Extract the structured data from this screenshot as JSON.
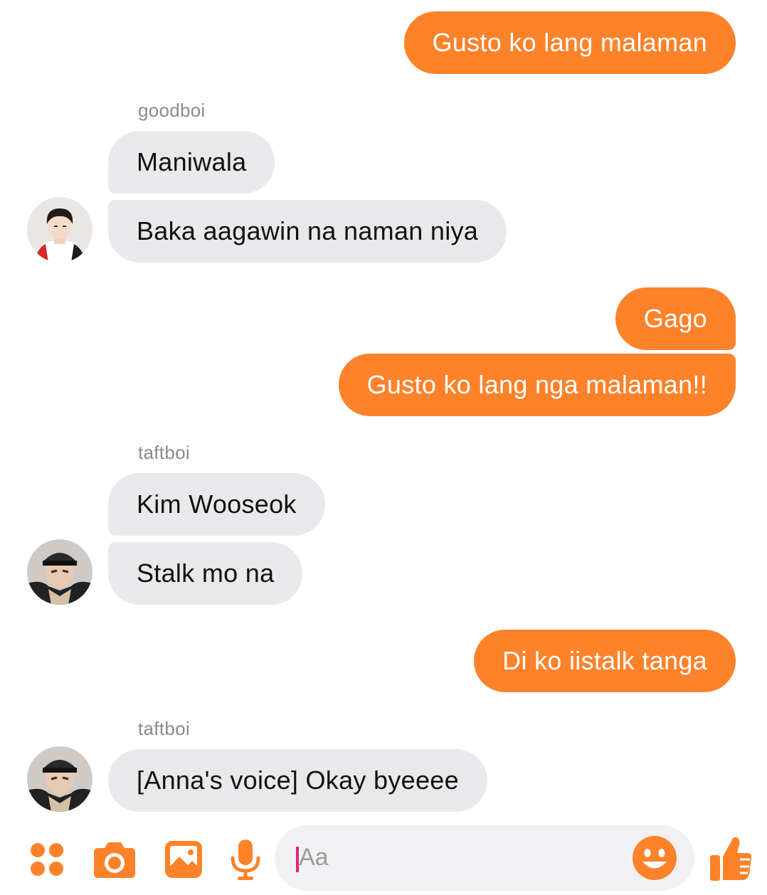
{
  "messages": [
    {
      "side": "out",
      "text": "Gusto ko lang malaman"
    },
    {
      "side": "in",
      "sender": "goodboi",
      "text": "Maniwala"
    },
    {
      "side": "in",
      "text": "Baka aagawin na naman niya"
    },
    {
      "side": "out",
      "text": "Gago"
    },
    {
      "side": "out",
      "text": "Gusto ko lang nga malaman!!"
    },
    {
      "side": "in",
      "sender": "taftboi",
      "text": "Kim Wooseok"
    },
    {
      "side": "in",
      "text": "Stalk mo na"
    },
    {
      "side": "out",
      "text": "Di ko iistalk tanga"
    },
    {
      "side": "in",
      "sender": "taftboi",
      "text": "[Anna's voice] Okay byeeee"
    }
  ],
  "composer": {
    "placeholder": "Aa",
    "icons": [
      "apps-grid-icon",
      "camera-icon",
      "gallery-icon",
      "microphone-icon",
      "emoji-icon",
      "thumbs-up-icon"
    ]
  },
  "colors": {
    "accent": "#fd822a",
    "incoming_bubble": "#e9e9eb",
    "sender_label": "#8a8a8a",
    "caret": "#e2237b"
  }
}
